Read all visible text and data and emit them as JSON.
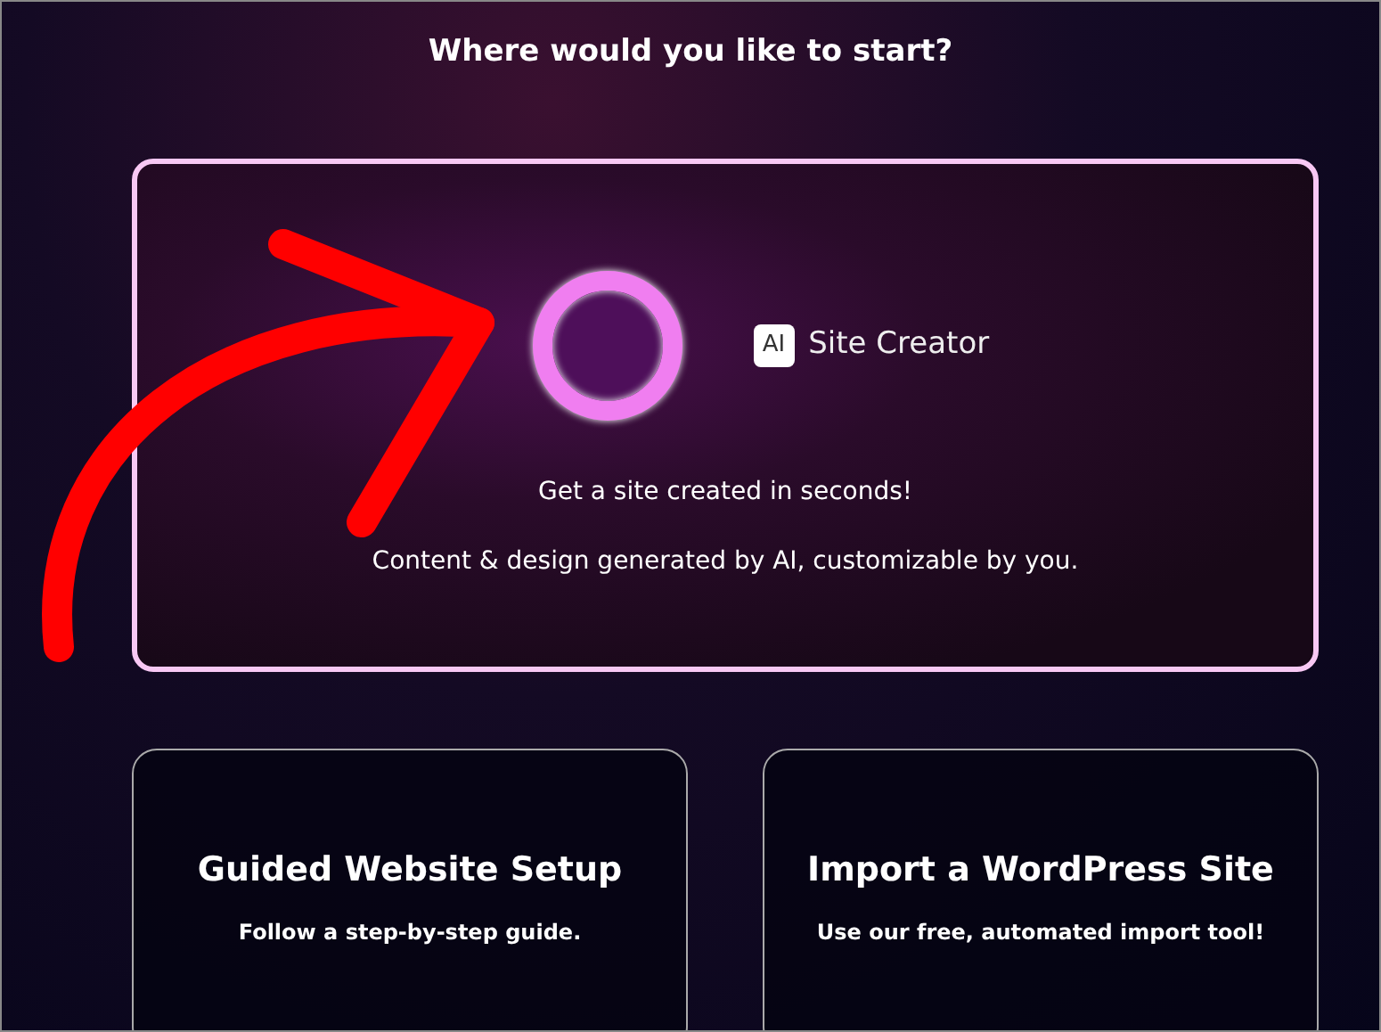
{
  "heading": "Where would you like to start?",
  "featured": {
    "badge": "AI",
    "product": "Site Creator",
    "tagline": "Get a site created in seconds!",
    "description": "Content & design generated by AI, customizable by you.",
    "selected": true
  },
  "options": [
    {
      "title": "Guided Website Setup",
      "subtitle": "Follow a step-by-step guide."
    },
    {
      "title": "Import a WordPress Site",
      "subtitle": "Use our free, automated import tool!"
    }
  ]
}
